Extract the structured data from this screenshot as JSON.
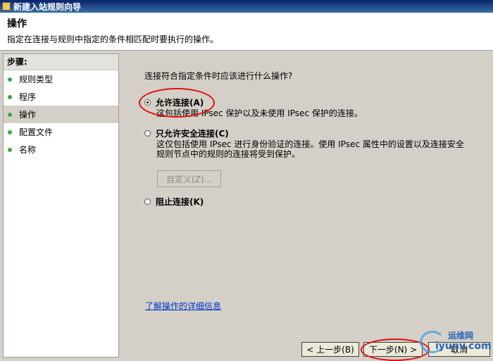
{
  "window": {
    "title": "新建入站规则向导"
  },
  "header": {
    "title": "操作",
    "description": "指定在连接与规则中指定的条件相匹配时要执行的操作。"
  },
  "sidebar": {
    "heading": "步骤:",
    "steps": [
      {
        "label": "规则类型",
        "current": false
      },
      {
        "label": "程序",
        "current": false
      },
      {
        "label": "操作",
        "current": true
      },
      {
        "label": "配置文件",
        "current": false
      },
      {
        "label": "名称",
        "current": false
      }
    ]
  },
  "main": {
    "question": "连接符合指定条件时应该进行什么操作?",
    "options": [
      {
        "label": "允许连接(A)",
        "description": "这包括使用 IPsec 保护以及未使用 IPsec 保护的连接。",
        "checked": true
      },
      {
        "label": "只允许安全连接(C)",
        "description": "这仅包括使用 IPsec 进行身份验证的连接。使用 IPsec 属性中的设置以及连接安全规则节点中的规则的连接将受到保护。",
        "checked": false
      },
      {
        "label": "阻止连接(K)",
        "description": "",
        "checked": false
      }
    ],
    "customize_button": "自定义(Z)...",
    "learn_more_link": "了解操作的详细信息"
  },
  "footer": {
    "back_button": "< 上一步(B)",
    "next_button": "下一步(N) >",
    "cancel_button": "取消"
  },
  "watermark": {
    "top": "运维网",
    "bottom": "iyunv.com"
  },
  "colors": {
    "annotation": "#e01010",
    "step_dot": "#3aa83a",
    "link": "#0033cc"
  }
}
